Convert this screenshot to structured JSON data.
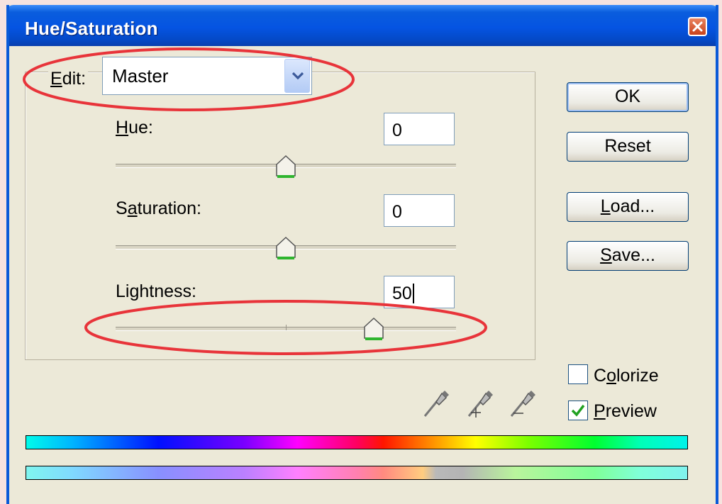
{
  "window": {
    "title": "Hue/Saturation"
  },
  "edit": {
    "label_u": "E",
    "label_rest": "dit:",
    "value": "Master"
  },
  "hue": {
    "label_u": "H",
    "label_rest": "ue:",
    "value": "0"
  },
  "saturation": {
    "label_pre": "S",
    "label_u": "a",
    "label_rest": "turation:",
    "value": "0"
  },
  "lightness": {
    "label": "Lightness:",
    "value": "50"
  },
  "buttons": {
    "ok": "OK",
    "reset": "Reset",
    "load_u": "L",
    "load_rest": "oad...",
    "save_u": "S",
    "save_rest": "ave..."
  },
  "colorize": {
    "label_pre": "C",
    "label_u": "o",
    "label_rest": "lorize",
    "checked": false
  },
  "preview": {
    "label_u": "P",
    "label_rest": "review",
    "checked": true
  },
  "icons": [
    "eyedropper-icon",
    "eyedropper-plus-icon",
    "eyedropper-minus-icon"
  ],
  "colors": {
    "annotation": "#e8343a",
    "title_bar": "#0554e2",
    "dialog_bg": "#ece9d8"
  }
}
